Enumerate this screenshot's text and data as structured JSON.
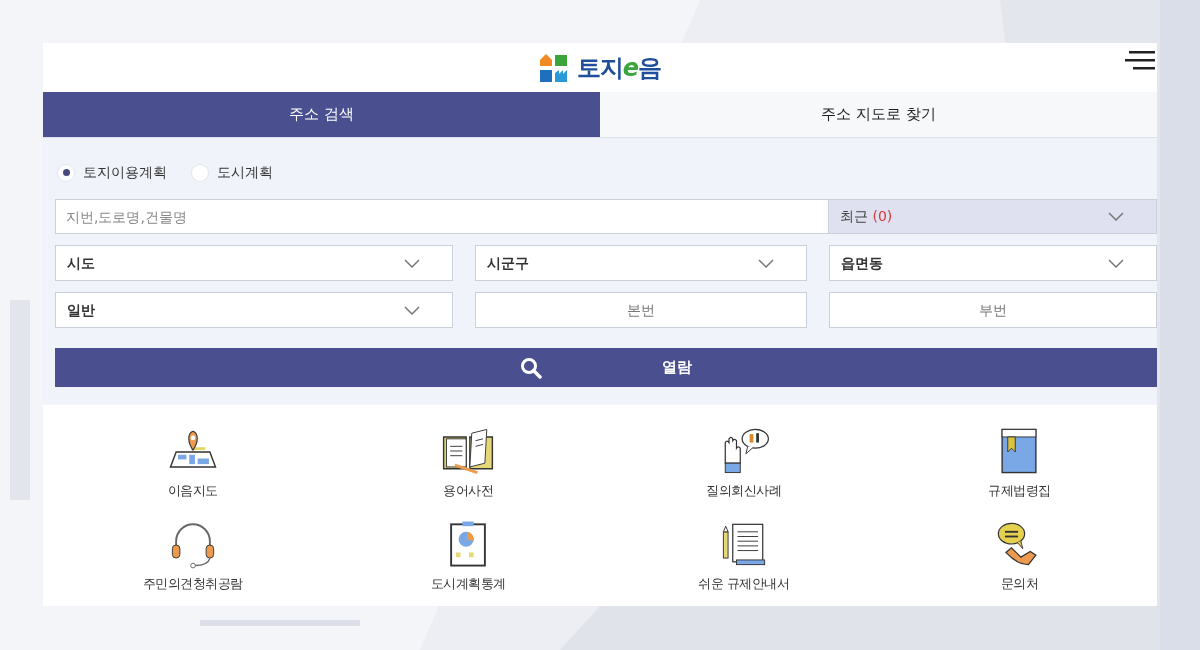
{
  "header": {
    "logo_parts": [
      "토지",
      "e",
      "음"
    ]
  },
  "tabs": [
    {
      "label": "주소 검색",
      "selected": true
    },
    {
      "label": "주소 지도로 찾기",
      "selected": false
    }
  ],
  "plan_types": [
    {
      "label": "토지이용계획",
      "selected": true
    },
    {
      "label": "도시계획",
      "selected": false
    }
  ],
  "search": {
    "placeholder": "지번,도로명,건물명"
  },
  "recent": {
    "label": "최근",
    "count": "(0)"
  },
  "selects": [
    {
      "value": "시도"
    },
    {
      "value": "시군구"
    },
    {
      "value": "읍면동"
    },
    {
      "value": "일반"
    }
  ],
  "lot_fields": [
    {
      "placeholder": "본번"
    },
    {
      "placeholder": "부번"
    }
  ],
  "view_button": {
    "label": "열람"
  },
  "shortcuts": [
    {
      "kind": "map",
      "label": "이음지도"
    },
    {
      "kind": "book",
      "label": "용어사전"
    },
    {
      "kind": "question",
      "label": "질의회신사례"
    },
    {
      "kind": "law",
      "label": "규제법령집"
    },
    {
      "kind": "headset",
      "label": "주민의견청취공람"
    },
    {
      "kind": "stats",
      "label": "도시계획통계"
    },
    {
      "kind": "guide",
      "label": "쉬운 규제안내서"
    },
    {
      "kind": "phone",
      "label": "문의처"
    }
  ]
}
